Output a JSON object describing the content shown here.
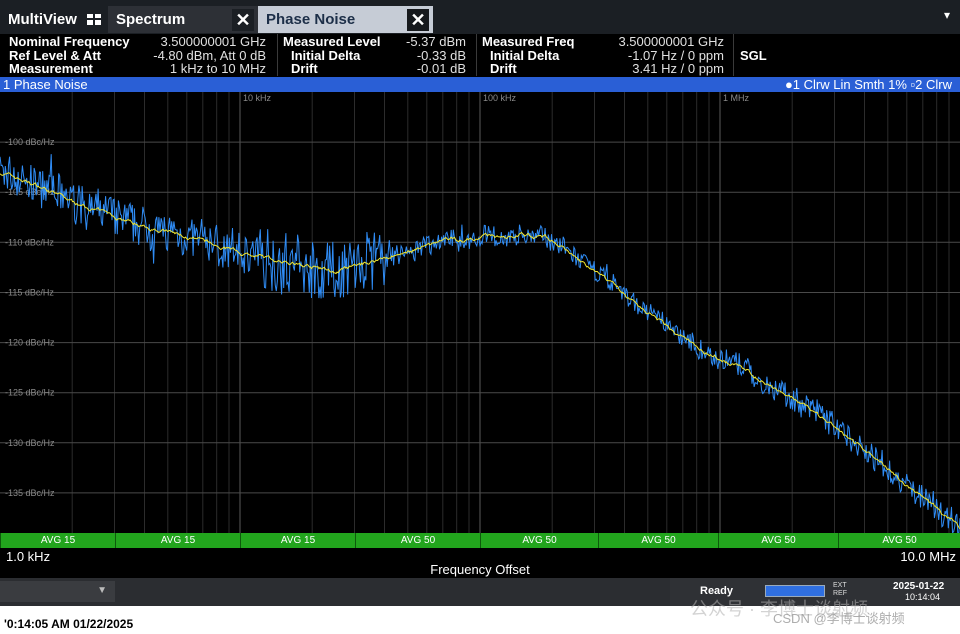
{
  "tabs": [
    {
      "label": "MultiView"
    },
    {
      "label": "Spectrum"
    },
    {
      "label": "Phase Noise"
    }
  ],
  "info": {
    "col1": [
      {
        "label": "Nominal Frequency",
        "value": "3.500000001 GHz"
      },
      {
        "label": "Ref Level & Att",
        "value": "-4.80 dBm, Att 0 dB"
      },
      {
        "label": "Measurement",
        "value": "1 kHz to 10 MHz"
      }
    ],
    "col2": [
      {
        "label": "Measured Level",
        "value": "-5.37 dBm"
      },
      {
        "label": "Initial Delta",
        "value": "-0.33 dB"
      },
      {
        "label": "Drift",
        "value": "-0.01 dB"
      }
    ],
    "col3": [
      {
        "label": "Measured Freq",
        "value": "3.500000001 GHz"
      },
      {
        "label": "Initial Delta",
        "value": "-1.07 Hz / 0 ppm"
      },
      {
        "label": "Drift",
        "value": "3.41 Hz / 0 ppm"
      }
    ],
    "mode": "SGL"
  },
  "window": {
    "title": "1 Phase Noise",
    "trace_info": "●1 Clrw Lin Smth 1% ▫2 Clrw"
  },
  "avg_segments": [
    "AVG 15",
    "AVG 15",
    "AVG 15",
    "AVG 50",
    "AVG 50",
    "AVG 50",
    "AVG 50",
    "AVG 50"
  ],
  "x_axis": {
    "start": "1.0 kHz",
    "stop": "10.0 MHz",
    "label": "Frequency Offset"
  },
  "status": {
    "ready": "Ready",
    "ext_ref": [
      "EXT",
      "REF"
    ],
    "date": "2025-01-22",
    "time": "10:14:04"
  },
  "footer": "'0:14:05 AM  01/22/2025",
  "watermark": "公众号 · 李博士谈射频",
  "csdn": "CSDN @李博士谈射频",
  "colors": {
    "trace1": "#2f8cf5",
    "trace2": "#f2e72e",
    "title_bar": "#2a5fd6",
    "avg_bar": "#22a51d"
  },
  "chart_data": {
    "type": "line",
    "xlabel": "Frequency Offset",
    "ylabel": "",
    "x_scale": "log",
    "xlim": [
      1000,
      10000000
    ],
    "ylim": [
      -139,
      -95
    ],
    "x_tick_labels": [
      {
        "x": 10000,
        "label": "10 kHz"
      },
      {
        "x": 100000,
        "label": "100 kHz"
      },
      {
        "x": 1000000,
        "label": "1 MHz"
      }
    ],
    "y_tick_labels": [
      {
        "y": -100,
        "label": "-100 dBc/Hz"
      },
      {
        "y": -105,
        "label": "-105 dBc/Hz"
      },
      {
        "y": -110,
        "label": "-110 dBc/Hz"
      },
      {
        "y": -115,
        "label": "-115 dBc/Hz"
      },
      {
        "y": -120,
        "label": "-120 dBc/Hz"
      },
      {
        "y": -125,
        "label": "-125 dBc/Hz"
      },
      {
        "y": -130,
        "label": "-130 dBc/Hz"
      },
      {
        "y": -135,
        "label": "-135 dBc/Hz"
      }
    ],
    "grid": true,
    "series": [
      {
        "name": "1",
        "x": [
          1000,
          1500,
          2000,
          3000,
          5000,
          7000,
          10000,
          15000,
          20000,
          25000,
          30000,
          40000,
          50000,
          70000,
          100000,
          150000,
          200000,
          300000,
          500000,
          700000,
          1000000,
          2000000,
          3000000,
          5000000,
          7000000,
          10000000
        ],
        "y": [
          -103,
          -104.5,
          -106,
          -107.5,
          -109,
          -110,
          -111,
          -112,
          -112.5,
          -113,
          -112.5,
          -111.5,
          -110.8,
          -110,
          -109.5,
          -109.2,
          -109.8,
          -113,
          -117,
          -119.5,
          -121.5,
          -125.3,
          -128.5,
          -132.5,
          -135.5,
          -138.5
        ]
      }
    ]
  }
}
